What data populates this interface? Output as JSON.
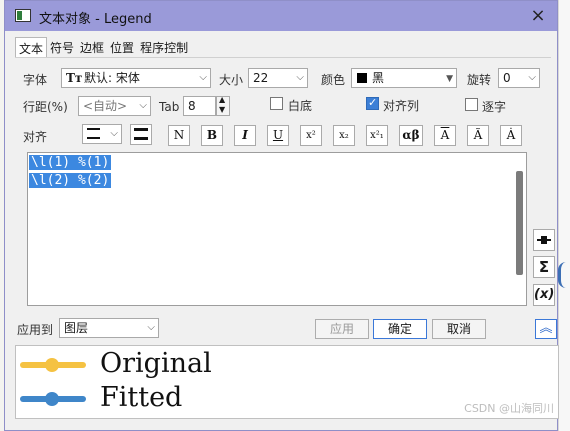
{
  "window": {
    "title": "文本对象 - Legend",
    "close_icon": "×"
  },
  "tabs": [
    {
      "label": "文本"
    },
    {
      "label": "符号"
    },
    {
      "label": "边框"
    },
    {
      "label": "位置"
    },
    {
      "label": "程序控制"
    }
  ],
  "text_tab": {
    "font_label": "字体",
    "font_value": "默认: 宋体",
    "size_label": "大小",
    "size_value": "22",
    "color_label": "颜色",
    "color_value": "黑",
    "color_swatch": "#000000",
    "rotate_label": "旋转",
    "rotate_value": "0",
    "spacing_label": "行距(%)",
    "spacing_value": "<自动>",
    "tab_label": "Tab",
    "tab_value": "8",
    "white_bg_label": "白底",
    "white_bg_checked": false,
    "align_col_label": "对齐列",
    "align_col_checked": true,
    "char_by_char_label": "逐字",
    "char_by_char_checked": false,
    "align_label": "对齐",
    "format_buttons": {
      "normal": "N",
      "bold": "B",
      "italic": "I",
      "underline": "U",
      "superscript": "x²",
      "subscript": "x₂",
      "supsub": "x²₁",
      "greek": "αβ",
      "overbar": "A",
      "tilde": "Ã",
      "dot": "Ȧ"
    },
    "editor_lines": [
      "\\l(1) %(1)",
      "\\l(2) %(2)"
    ]
  },
  "side_tools": {
    "legend_symbol": "-■-",
    "sigma": "Σ",
    "variable": "(x)"
  },
  "footer": {
    "apply_to_label": "应用到",
    "apply_to_value": "图层",
    "apply_button": "应用",
    "ok_button": "确定",
    "cancel_button": "取消",
    "collapse_icon": "︽"
  },
  "preview": {
    "entries": [
      {
        "label": "Original",
        "color": "#f5c242"
      },
      {
        "label": "Fitted",
        "color": "#3f86c9"
      }
    ]
  },
  "watermark": "CSDN @山海同川"
}
